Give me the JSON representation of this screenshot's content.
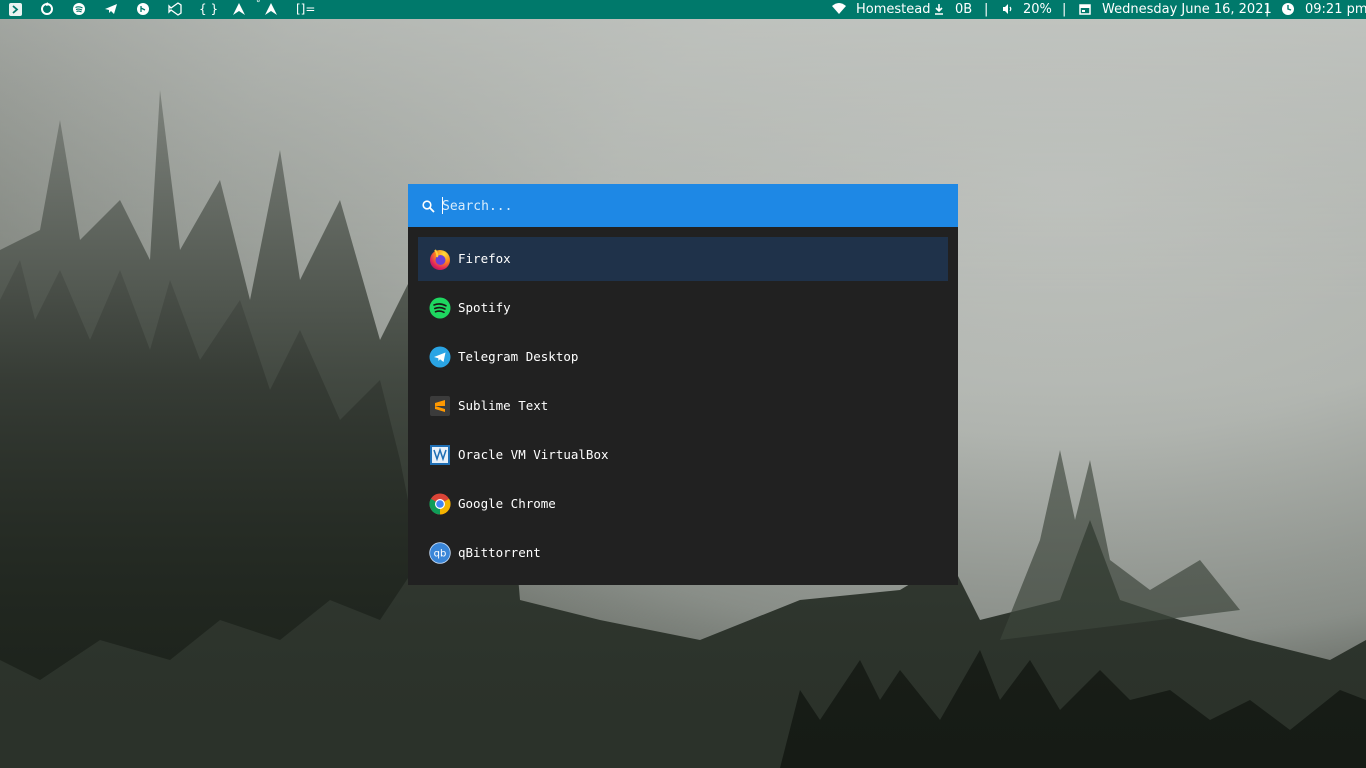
{
  "topbar": {
    "workspace_icons": [
      "terminal-icon",
      "update-icon",
      "spotify-icon",
      "telegram-icon",
      "git-icon",
      "vscode-icon",
      "braces-icon",
      "arch-icon",
      "arch-alt-icon",
      "layout-icon"
    ],
    "wifi_name": "Homestead",
    "download": "0B",
    "volume": "20%",
    "date": "Wednesday June 16, 2021",
    "time": "09:21 pm",
    "separator": "|",
    "accent": "#00796b"
  },
  "launcher": {
    "search_placeholder": "Search...",
    "search_value": "",
    "accent": "#1e88e5",
    "selected_bg": "#1f324a",
    "items": [
      {
        "label": "Firefox",
        "icon": "firefox-icon"
      },
      {
        "label": "Spotify",
        "icon": "spotify-icon"
      },
      {
        "label": "Telegram Desktop",
        "icon": "telegram-icon"
      },
      {
        "label": "Sublime Text",
        "icon": "sublime-icon"
      },
      {
        "label": "Oracle VM VirtualBox",
        "icon": "virtualbox-icon"
      },
      {
        "label": "Google Chrome",
        "icon": "chrome-icon"
      },
      {
        "label": "qBittorrent",
        "icon": "qbittorrent-icon"
      }
    ]
  }
}
